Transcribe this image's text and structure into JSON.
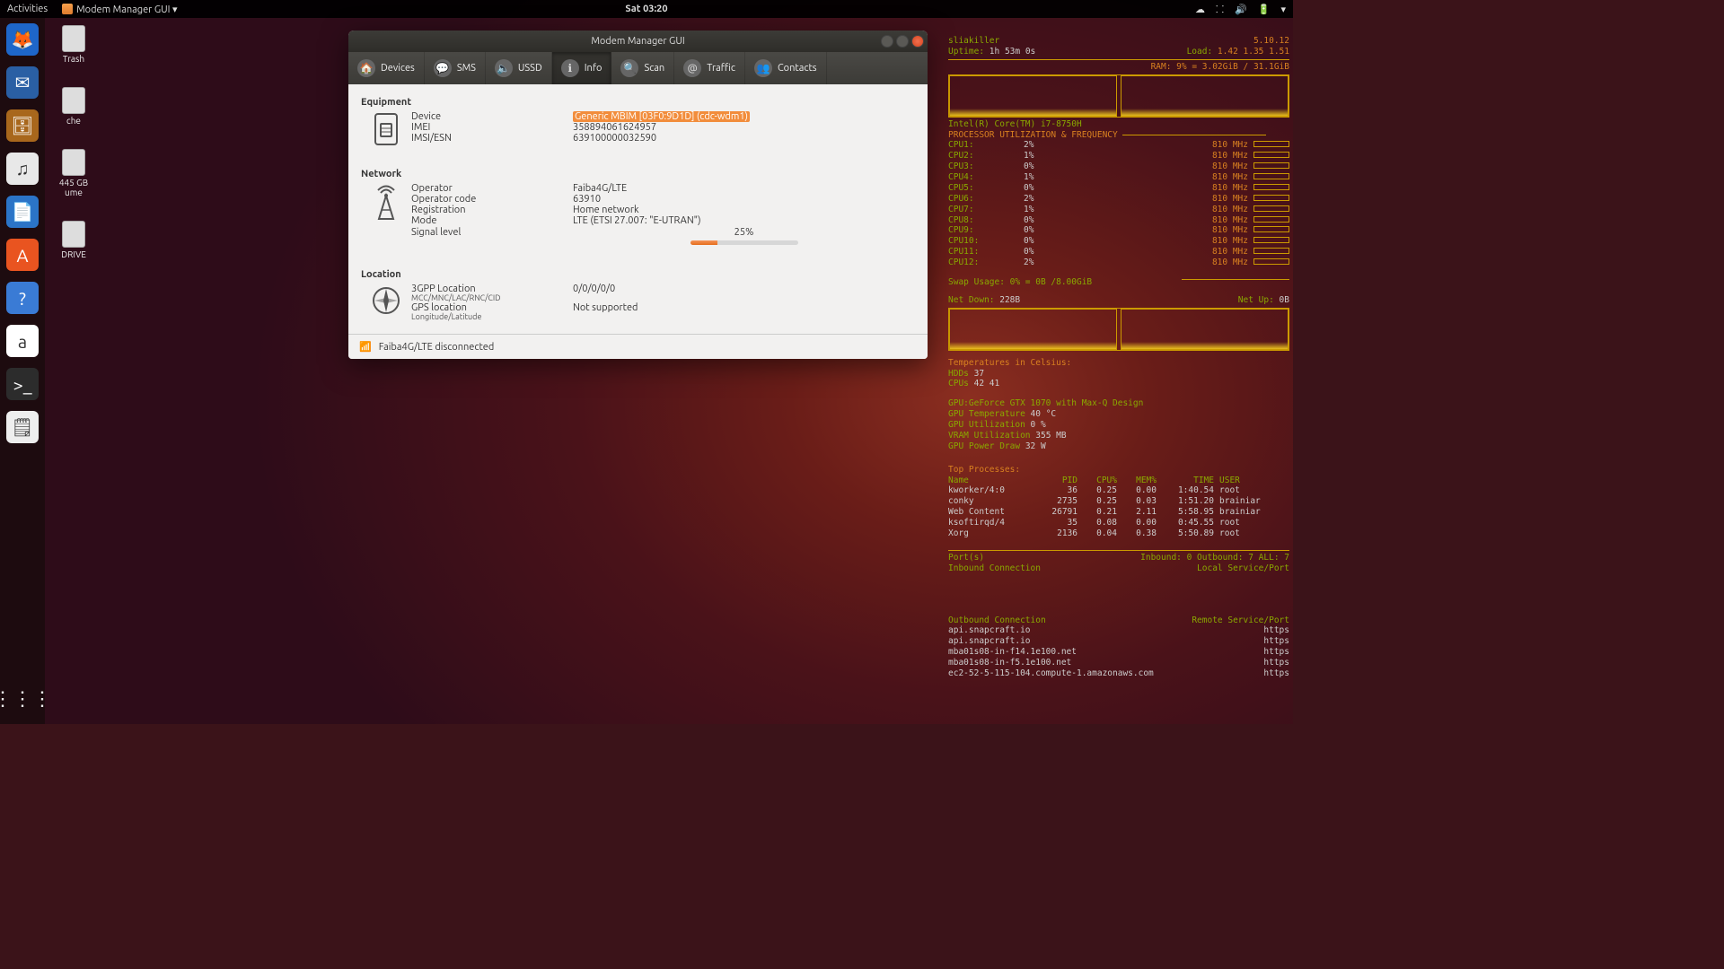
{
  "topbar": {
    "activities": "Activities",
    "app": "Modem Manager GUI ▾",
    "clock": "Sat 03:20"
  },
  "dock": [
    {
      "name": "firefox",
      "glyph": "🦊",
      "bg": "#1e66c9"
    },
    {
      "name": "thunderbird",
      "glyph": "✉",
      "bg": "#2a5fa4"
    },
    {
      "name": "files",
      "glyph": "🗄",
      "bg": "#a8671c"
    },
    {
      "name": "rhythmbox",
      "glyph": "♫",
      "bg": "#e8e8e8"
    },
    {
      "name": "libreoffice-writer",
      "glyph": "📄",
      "bg": "#2b74c7"
    },
    {
      "name": "ubuntu-software",
      "glyph": "A",
      "bg": "#e95420"
    },
    {
      "name": "help",
      "glyph": "?",
      "bg": "#3a7bd5"
    },
    {
      "name": "amazon",
      "glyph": "a",
      "bg": "#fff"
    },
    {
      "name": "terminal",
      "glyph": ">_",
      "bg": "#2c2c2c"
    },
    {
      "name": "text-editor",
      "glyph": "🗒",
      "bg": "#eee"
    }
  ],
  "desk_icons": [
    {
      "label": "Trash"
    },
    {
      "label": "che"
    },
    {
      "label": "445 GB\nume"
    },
    {
      "label": "DRIVE"
    }
  ],
  "window": {
    "title": "Modem Manager GUI",
    "tabs": [
      {
        "id": "devices",
        "label": "Devices",
        "icon": "🏠"
      },
      {
        "id": "sms",
        "label": "SMS",
        "icon": "💬"
      },
      {
        "id": "ussd",
        "label": "USSD",
        "icon": "🔈"
      },
      {
        "id": "info",
        "label": "Info",
        "icon": "ℹ",
        "active": true
      },
      {
        "id": "scan",
        "label": "Scan",
        "icon": "🔍"
      },
      {
        "id": "traffic",
        "label": "Traffic",
        "icon": "@"
      },
      {
        "id": "contacts",
        "label": "Contacts",
        "icon": "👥"
      }
    ],
    "sections": {
      "equipment": {
        "title": "Equipment",
        "rows": [
          {
            "label": "Device",
            "value": "Generic MBIM [03F0:9D1D] (cdc-wdm1)",
            "highlight": true
          },
          {
            "label": "IMEI",
            "value": "358894061624957"
          },
          {
            "label": "IMSI/ESN",
            "value": "639100000032590"
          }
        ]
      },
      "network": {
        "title": "Network",
        "rows": [
          {
            "label": "Operator",
            "value": "Faiba4G/LTE"
          },
          {
            "label": "Operator code",
            "value": "63910"
          },
          {
            "label": "Registration",
            "value": "Home network"
          },
          {
            "label": "Mode",
            "value": "LTE (ETSI 27.007: \"E-UTRAN\")"
          }
        ],
        "signal": {
          "label": "Signal level",
          "pct": 25,
          "text": "25%"
        }
      },
      "location": {
        "title": "Location",
        "rows": [
          {
            "label": "3GPP Location",
            "sub": "MCC/MNC/LAC/RNC/CID",
            "value": "0/0/0/0/0"
          },
          {
            "label": "GPS location",
            "sub": "Longitude/Latitude",
            "value": "Not supported"
          }
        ]
      }
    },
    "status": "Faiba4G/LTE disconnected"
  },
  "conky": {
    "host": "sliakiller",
    "kernel": "5.10.12",
    "uptime_label": "Uptime:",
    "uptime": "1h 53m 0s",
    "load_label": "Load:",
    "load": "1.42 1.35 1.51",
    "ram": "RAM: 9% = 3.02GiB / 31.1GiB",
    "cpu_model": "Intel(R) Core(TM) i7-8750H",
    "cpu_header": "PROCESSOR UTILIZATION & FREQUENCY",
    "cores": [
      {
        "name": "CPU1:",
        "pct": "2%",
        "freq": "810 MHz"
      },
      {
        "name": "CPU2:",
        "pct": "1%",
        "freq": "810 MHz"
      },
      {
        "name": "CPU3:",
        "pct": "0%",
        "freq": "810 MHz"
      },
      {
        "name": "CPU4:",
        "pct": "1%",
        "freq": "810 MHz"
      },
      {
        "name": "CPU5:",
        "pct": "0%",
        "freq": "810 MHz"
      },
      {
        "name": "CPU6:",
        "pct": "2%",
        "freq": "810 MHz"
      },
      {
        "name": "CPU7:",
        "pct": "1%",
        "freq": "810 MHz"
      },
      {
        "name": "CPU8:",
        "pct": "0%",
        "freq": "810 MHz"
      },
      {
        "name": "CPU9:",
        "pct": "0%",
        "freq": "810 MHz"
      },
      {
        "name": "CPU10:",
        "pct": "0%",
        "freq": "810 MHz"
      },
      {
        "name": "CPU11:",
        "pct": "0%",
        "freq": "810 MHz"
      },
      {
        "name": "CPU12:",
        "pct": "2%",
        "freq": "810 MHz"
      }
    ],
    "swap": "Swap Usage: 0% = 0B  /8.00GiB",
    "net_down_label": "Net Down:",
    "net_down": "228B",
    "net_up_label": "Net Up:",
    "net_up": "0B",
    "temps_header": "Temperatures in Celsius:",
    "hdd_line": "HDDs  37",
    "cpu_temp_line": "CPUs  42    41",
    "gpu": {
      "model": "GPU:GeForce GTX 1070 with Max-Q Design",
      "temp": "GPU Temperature    40 °C",
      "util": "GPU Utilization    0 %",
      "vram": "VRAM Utilization   355 MB",
      "power": "GPU Power Draw    32 W"
    },
    "top_header": "Top Processes:",
    "top_cols": {
      "name": "Name",
      "pid": "PID",
      "cpu": "CPU%",
      "mem": "MEM%",
      "time": "TIME",
      "user": "USER"
    },
    "procs": [
      {
        "n": "kworker/4:0",
        "p": "36",
        "c": "0.25",
        "m": "0.00",
        "t": "1:40.54",
        "u": "root"
      },
      {
        "n": "conky",
        "p": "2735",
        "c": "0.25",
        "m": "0.03",
        "t": "1:51.20",
        "u": "brainiar"
      },
      {
        "n": "Web Content",
        "p": "26791",
        "c": "0.21",
        "m": "2.11",
        "t": "5:58.95",
        "u": "brainiar"
      },
      {
        "n": "ksoftirqd/4",
        "p": "35",
        "c": "0.08",
        "m": "0.00",
        "t": "0:45.55",
        "u": "root"
      },
      {
        "n": "Xorg",
        "p": "2136",
        "c": "0.04",
        "m": "0.38",
        "t": "5:50.89",
        "u": "root"
      }
    ],
    "ports": {
      "label": "Port(s)",
      "summary": "Inbound: 0  Outbound: 7  ALL: 7"
    },
    "inbound": {
      "label": "Inbound Connection",
      "right": "Local Service/Port"
    },
    "outbound": {
      "label": "Outbound Connection",
      "right": "Remote Service/Port"
    },
    "out_conns": [
      {
        "host": "api.snapcraft.io",
        "svc": "https"
      },
      {
        "host": "api.snapcraft.io",
        "svc": "https"
      },
      {
        "host": "mba01s08-in-f14.1e100.net",
        "svc": "https"
      },
      {
        "host": "mba01s08-in-f5.1e100.net",
        "svc": "https"
      },
      {
        "host": "ec2-52-5-115-104.compute-1.amazonaws.com",
        "svc": "https"
      }
    ]
  }
}
